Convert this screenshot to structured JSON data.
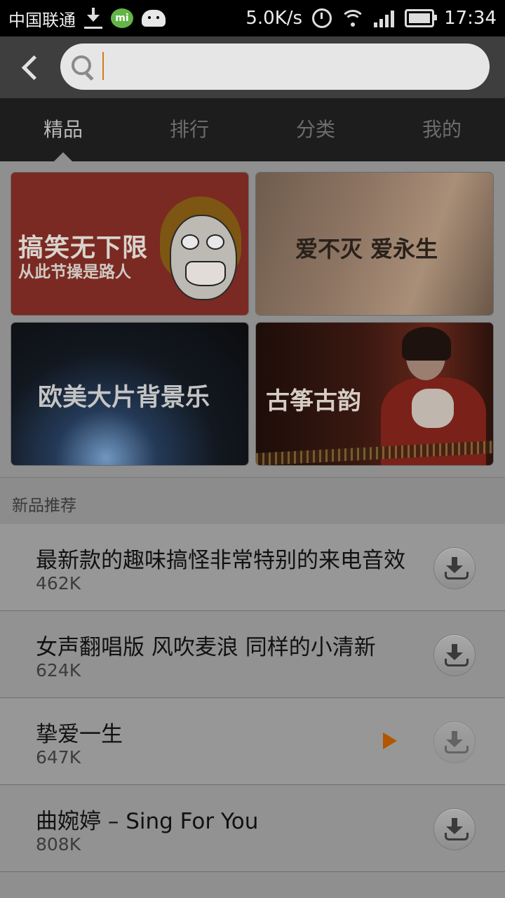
{
  "status_bar": {
    "carrier": "中国联通",
    "speed": "5.0K/s",
    "time": "17:34",
    "icons": [
      "download-icon",
      "mi-talk-icon",
      "android-icon",
      "alarm-clock-icon",
      "wifi-icon",
      "signal-icon",
      "battery-icon"
    ]
  },
  "search": {
    "placeholder": "",
    "value": ""
  },
  "tabs": [
    {
      "label": "精品",
      "active": true
    },
    {
      "label": "排行",
      "active": false
    },
    {
      "label": "分类",
      "active": false
    },
    {
      "label": "我的",
      "active": false
    }
  ],
  "banners": [
    {
      "title": "搞笑无下限",
      "subtitle": "从此节操是路人"
    },
    {
      "title": "爱不灭 爱永生"
    },
    {
      "title": "欧美大片背景乐"
    },
    {
      "title": "古筝古韵"
    }
  ],
  "section": {
    "title": "新品推荐"
  },
  "songs": [
    {
      "title": "最新款的趣味搞怪非常特别的来电音效",
      "size": "462K",
      "playing": false
    },
    {
      "title": "女声翻唱版 风吹麦浪 同样的小清新",
      "size": "624K",
      "playing": false
    },
    {
      "title": "挚爱一生",
      "size": "647K",
      "playing": true
    },
    {
      "title": "曲婉婷 – Sing For You",
      "size": "808K",
      "playing": false
    }
  ],
  "colors": {
    "accent_play": "#b35600",
    "caret": "#d67c1a",
    "status_bar_bg": "#000000",
    "tab_bar_bg": "#1d1d1d"
  }
}
